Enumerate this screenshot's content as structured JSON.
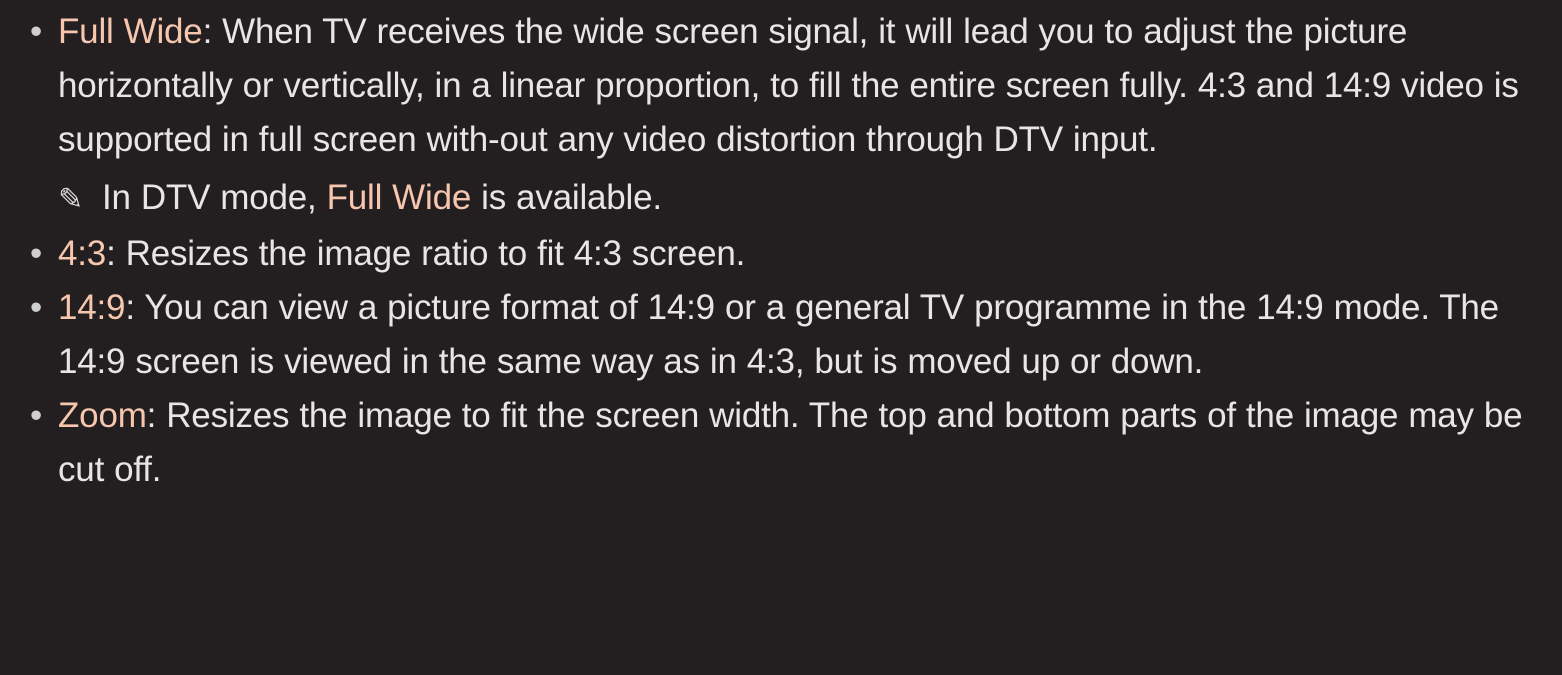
{
  "items": [
    {
      "term": "Full Wide",
      "separator": ":",
      "text": " When TV receives the wide screen signal, it will lead you to adjust the picture horizontally or vertically, in a linear proportion, to fill the entire screen fully. 4:3 and 14:9 video is supported in full screen with-out any video distortion through DTV input.",
      "note": {
        "icon": "pencil-icon",
        "before": " In DTV mode, ",
        "term": "Full Wide",
        "after": " is available."
      }
    },
    {
      "term": "4:3",
      "separator": ":",
      "text": " Resizes the image ratio to fit 4:3 screen."
    },
    {
      "term": "14:9",
      "separator": ":",
      "text": " You can view a picture format of 14:9 or a general TV programme in the 14:9 mode. The 14:9 screen is viewed in the same way as in 4:3, but is moved up or down."
    },
    {
      "term": "Zoom",
      "separator": ":",
      "text": " Resizes the image to fit the screen width. The top and bottom parts of the image may be cut off."
    }
  ],
  "bullet_symbol": "•",
  "colors": {
    "background": "#231f20",
    "text": "#e6e6e6",
    "term": "#f6c6ae"
  }
}
